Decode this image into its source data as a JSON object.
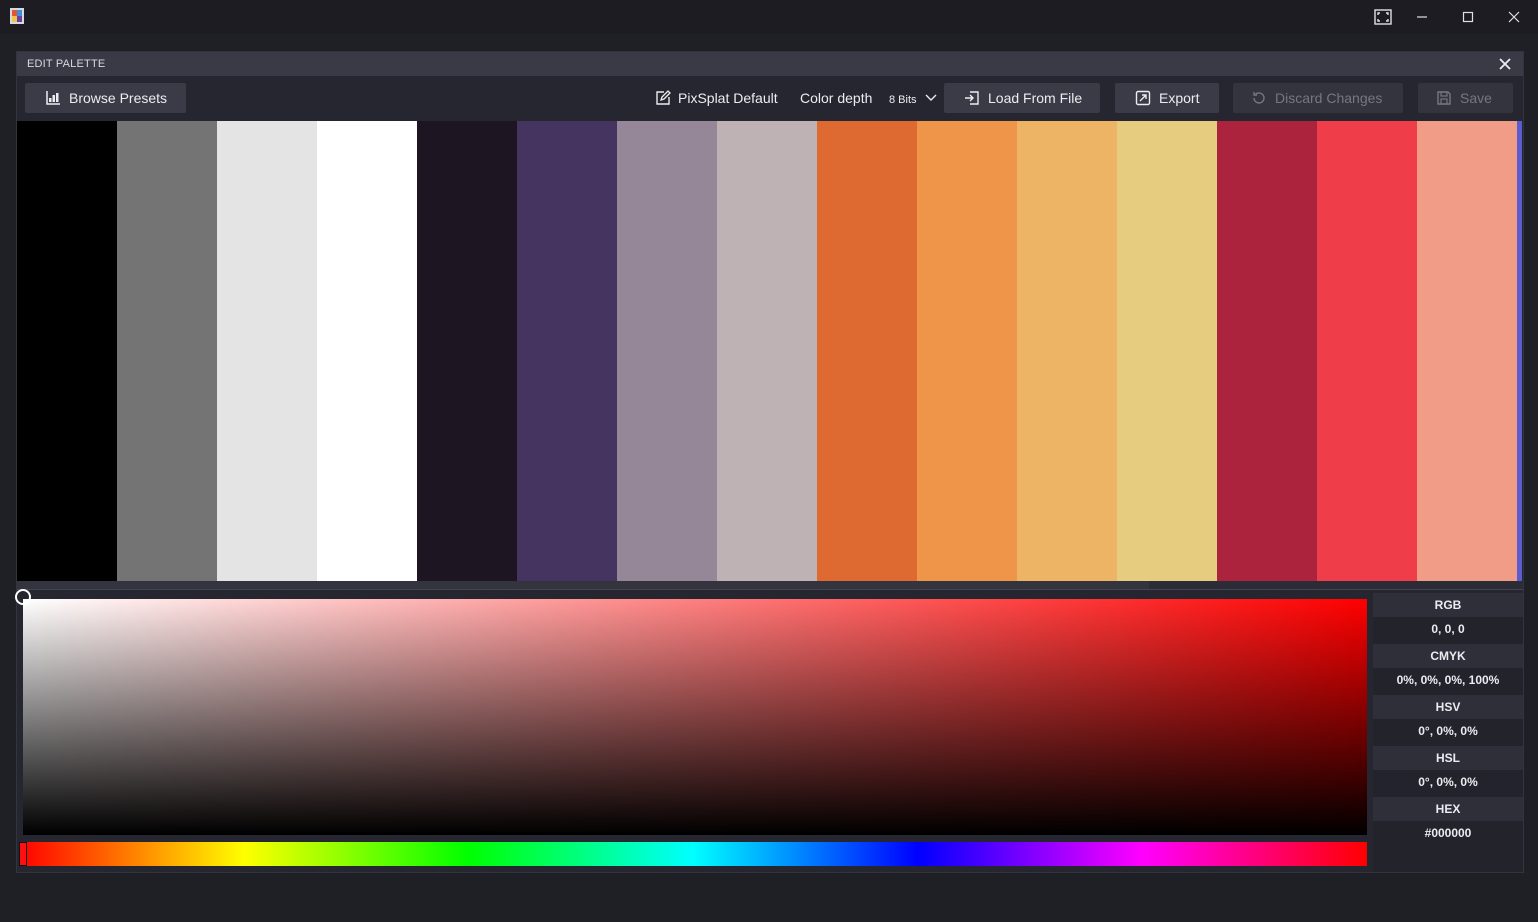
{
  "dialog": {
    "title": "EDIT PALETTE"
  },
  "toolbar": {
    "browse_presets": "Browse Presets",
    "palette_name": "PixSplat Default",
    "color_depth_label": "Color depth",
    "color_depth_value": "8 Bits",
    "load_from_file": "Load From File",
    "export": "Export",
    "discard_changes": "Discard Changes",
    "save": "Save"
  },
  "palette": {
    "swatches": [
      "#000000",
      "#747474",
      "#e4e4e4",
      "#ffffff",
      "#1e1523",
      "#45345f",
      "#958698",
      "#bfb2b5",
      "#de6a31",
      "#ee9549",
      "#eeb465",
      "#e6cc7f",
      "#ab233d",
      "#ef3e4a",
      "#f19c87"
    ]
  },
  "picker": {
    "hue_color": "#ff0000"
  },
  "info": {
    "rgb_label": "RGB",
    "rgb_value": "0, 0, 0",
    "cmyk_label": "CMYK",
    "cmyk_value": "0%, 0%, 0%, 100%",
    "hsv_label": "HSV",
    "hsv_value": "0°, 0%, 0%",
    "hsl_label": "HSL",
    "hsl_value": "0°, 0%, 0%",
    "hex_label": "HEX",
    "hex_value": "#000000"
  }
}
